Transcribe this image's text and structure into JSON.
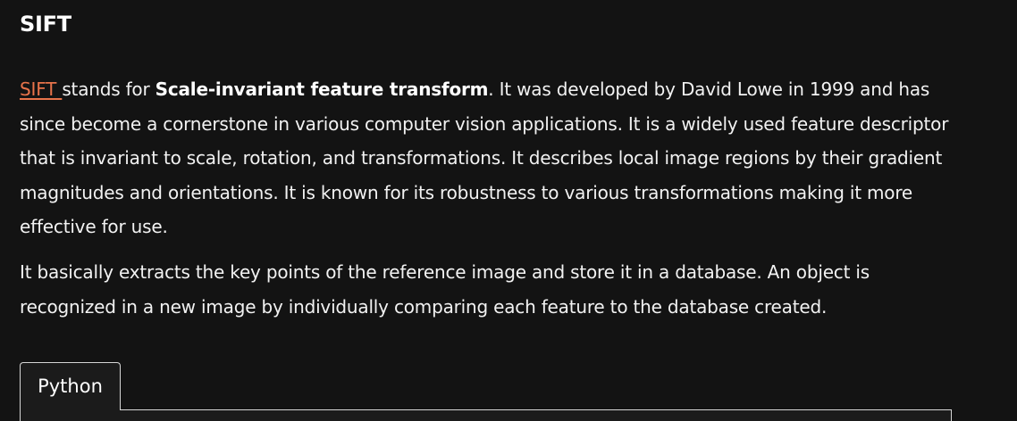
{
  "article": {
    "heading": "SIFT",
    "paragraph1": {
      "link": "SIFT ",
      "text_a": "stands for ",
      "bold": "Scale-invariant feature transform",
      "text_b": ". It was developed by David Lowe in 1999 and has since become a cornerstone in various computer vision applications. It is a widely used feature descriptor that is invariant to scale, rotation, and transformations. It describes local image regions by their gradient magnitudes and orientations. It is known for its robustness to various transformations making it more effective for use."
    },
    "paragraph2": "It basically extracts the key points of the reference image and store it in a database. An object is recognized in a new image by individually comparing each feature to the database created."
  },
  "code_tabs": {
    "tabs": [
      "Python"
    ],
    "active": "Python"
  }
}
